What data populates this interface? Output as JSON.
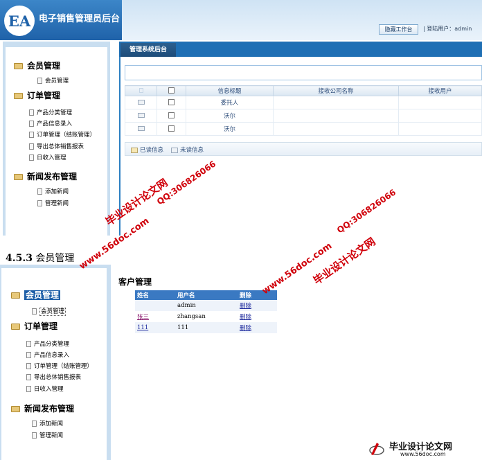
{
  "app": {
    "logo_text": "EA",
    "title": "电子销售管理员后台",
    "hide_button": "隐藏工作台",
    "login_info": "| 登陆用户：admin"
  },
  "nav": {
    "groups": [
      {
        "label": "会员管理",
        "items": [
          "会员管理"
        ]
      },
      {
        "label": "订单管理",
        "items": [
          "产品分类管理",
          "产品信息录入",
          "订单管理（结账管理）",
          "导出总体销售报表",
          "日收入管理"
        ]
      },
      {
        "label": "新闻发布管理",
        "items": [
          "添加新闻",
          "管理新闻"
        ]
      }
    ]
  },
  "top": {
    "tab_label": "管理系统后台",
    "table": {
      "headers": [
        "信息标题",
        "接收公司名称",
        "接收用户"
      ],
      "rows": [
        {
          "title": "委托人",
          "company": "",
          "user": ""
        },
        {
          "title": "沃尔",
          "company": "",
          "user": ""
        },
        {
          "title": "沃尔",
          "company": "",
          "user": ""
        }
      ]
    },
    "legend": {
      "read": "已读信息",
      "unread": "未读信息"
    }
  },
  "section_heading": {
    "number": "4.5.3",
    "text": " 会员管理"
  },
  "bottom": {
    "page_title": "客户管理",
    "table": {
      "headers": [
        "姓名",
        "用户名",
        "删除"
      ],
      "rows": [
        {
          "name": "",
          "username": "admin",
          "action": "删除"
        },
        {
          "name": "张三",
          "username": "zhangsan",
          "action": "删除"
        },
        {
          "name": "111",
          "username": "111",
          "action": "删除"
        }
      ]
    }
  },
  "watermarks": {
    "site_name": "毕业设计论文网",
    "qq": "QQ:306826066",
    "url": "www.56doc.com",
    "logo_title": "毕业设计论文网",
    "logo_url": "www.56doc.com"
  },
  "colors": {
    "header_blue": "#1f62a9",
    "tab_blue": "#1f6fb4",
    "table_header_blue": "#3a79c2",
    "watermark_red": "#d0000a",
    "sidebar_bg": "#c9def0"
  }
}
